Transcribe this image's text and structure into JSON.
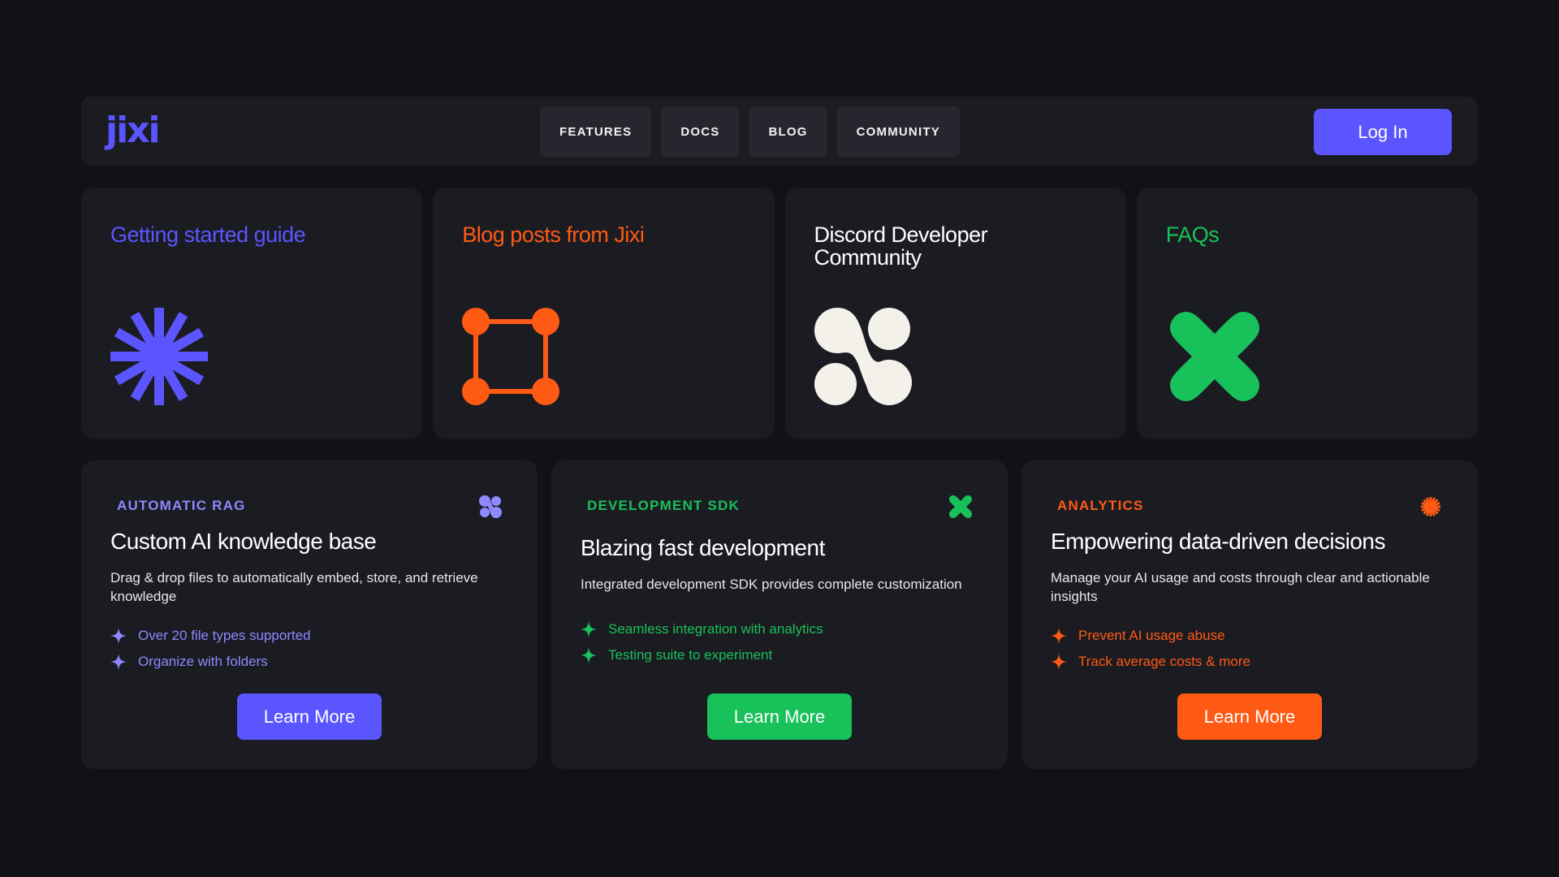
{
  "nav": {
    "logo": "jixi",
    "links": [
      "FEATURES",
      "DOCS",
      "BLOG",
      "COMMUNITY"
    ],
    "login_label": "Log In"
  },
  "colors": {
    "purple": "#5b55ff",
    "orange": "#ff5a14",
    "green": "#19c15a",
    "white": "#f4f1ea",
    "card_bg": "#1b1b22",
    "page_bg": "#111116"
  },
  "top_cards": [
    {
      "title": "Getting started guide",
      "icon": "asterisk-icon",
      "color": "#5b55ff"
    },
    {
      "title": "Blog posts from Jixi",
      "icon": "node-square-icon",
      "color": "#ff5a14"
    },
    {
      "title": "Discord Developer Community",
      "icon": "blob-clover-icon",
      "color": "#f4f1ea"
    },
    {
      "title": "FAQs",
      "icon": "rounded-x-icon",
      "color": "#19c15a"
    }
  ],
  "features": [
    {
      "tag": "AUTOMATIC RAG",
      "title": "Custom AI knowledge base",
      "description": "Drag & drop files to automatically embed, store, and retrieve knowledge",
      "bullets": [
        "Over 20 file types supported",
        "Organize with folders"
      ],
      "button": "Learn More",
      "icon": "clover-icon",
      "color": "#5b55ff",
      "bullet_color": "#8e89ff"
    },
    {
      "tag": "DEVELOPMENT SDK",
      "title": "Blazing fast development",
      "description": "Integrated development SDK provides complete customization",
      "bullets": [
        "Seamless integration with analytics",
        "Testing suite to experiment"
      ],
      "button": "Learn More",
      "icon": "x-icon",
      "color": "#19c15a",
      "bullet_color": "#19c15a"
    },
    {
      "tag": "ANALYTICS",
      "title": "Empowering data-driven decisions",
      "description": "Manage your AI usage and costs through clear and actionable insights",
      "bullets": [
        "Prevent AI usage abuse",
        "Track average costs & more"
      ],
      "button": "Learn More",
      "icon": "starburst-icon",
      "color": "#ff5a14",
      "bullet_color": "#ff5a14"
    }
  ]
}
